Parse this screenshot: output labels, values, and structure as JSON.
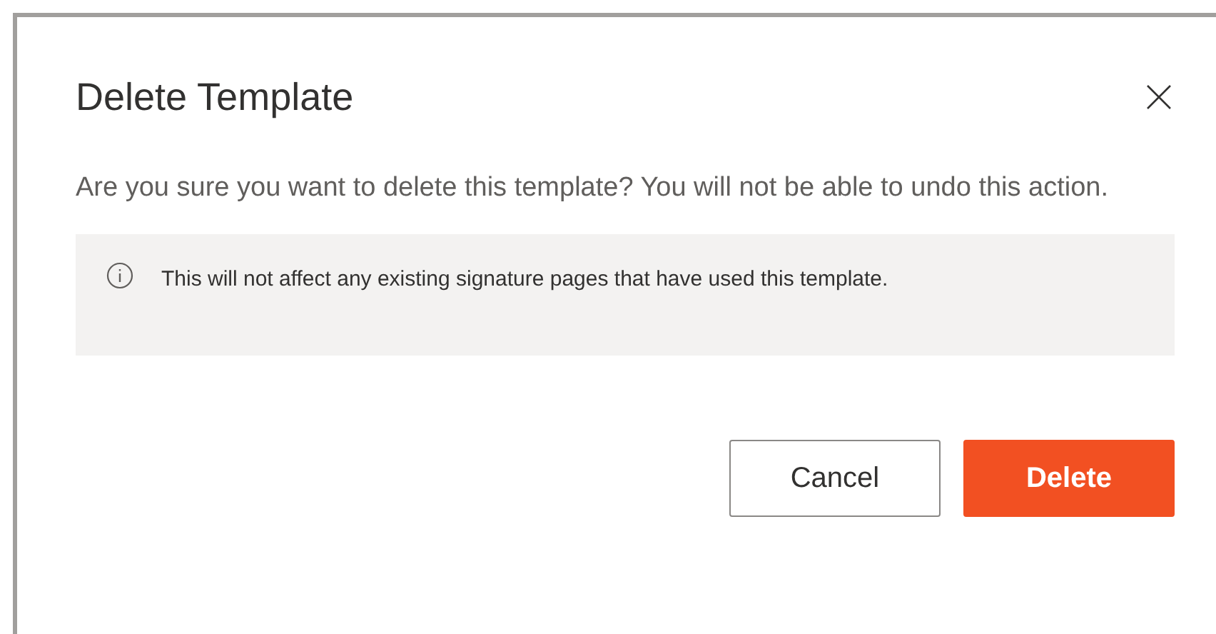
{
  "dialog": {
    "title": "Delete Template",
    "message": "Are you sure you want to delete this template? You will not be able to undo this action.",
    "info": "This will not affect any existing signature pages that have used this template.",
    "buttons": [
      {
        "label": "Cancel",
        "kind": "secondary"
      },
      {
        "label": "Delete",
        "kind": "primary"
      }
    ]
  }
}
